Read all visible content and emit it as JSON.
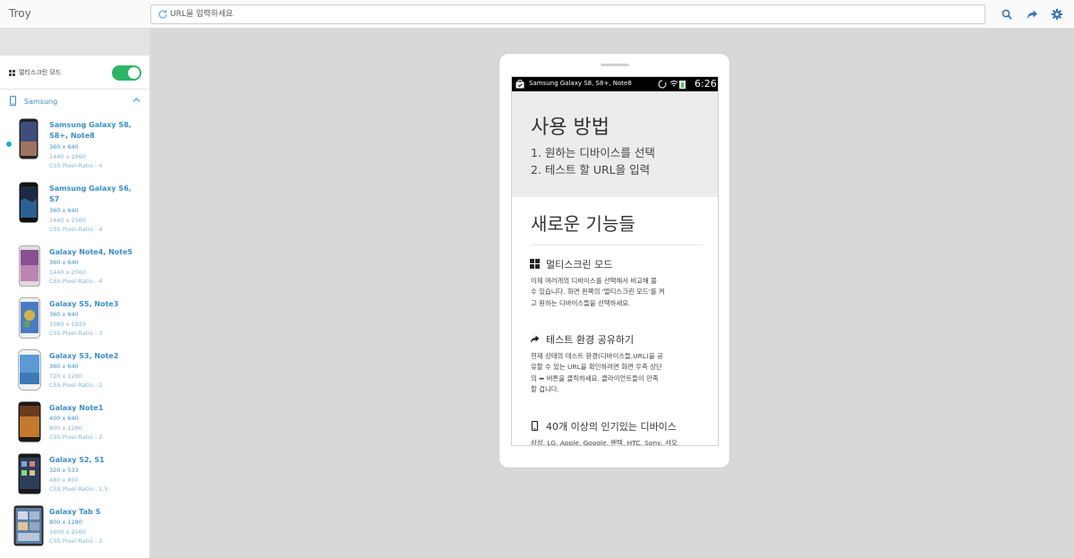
{
  "app": {
    "title": "Troy"
  },
  "urlbar": {
    "placeholder": "URL을 입력하세요",
    "value": ""
  },
  "toolbar": {
    "search_icon": "search-icon",
    "share_icon": "share-icon",
    "settings_icon": "gear-icon"
  },
  "sidebar": {
    "multiscreen": {
      "label": "멀티스크린 모드",
      "enabled": true
    },
    "group": {
      "label": "Samsung",
      "expanded": true
    },
    "devices": [
      {
        "name": "Samsung Galaxy S8, S8+, Note8",
        "viewport": "360 x 640",
        "resolution": "1440 x 2960",
        "ratio": "CSS Pixel-Ratio : 4",
        "selected": true
      },
      {
        "name": "Samsung Galaxy S6, S7",
        "viewport": "360 x 640",
        "resolution": "1440 x 2560",
        "ratio": "CSS Pixel-Ratio : 4",
        "selected": false
      },
      {
        "name": "Galaxy Note4, Note5",
        "viewport": "360 x 640",
        "resolution": "1440 x 2560",
        "ratio": "CSS Pixel-Ratio : 4",
        "selected": false
      },
      {
        "name": "Galaxy S5, Note3",
        "viewport": "360 x 640",
        "resolution": "1080 x 1920",
        "ratio": "CSS Pixel-Ratio : 3",
        "selected": false
      },
      {
        "name": "Galaxy S3, Note2",
        "viewport": "360 x 640",
        "resolution": "720 x 1280",
        "ratio": "CSS Pixel-Ratio : 2",
        "selected": false
      },
      {
        "name": "Galaxy Note1",
        "viewport": "400 x 640",
        "resolution": "800 x 1280",
        "ratio": "CSS Pixel-Ratio : 2",
        "selected": false
      },
      {
        "name": "Galaxy S2, S1",
        "viewport": "320 x 533",
        "resolution": "480 x 800",
        "ratio": "CSS Pixel-Ratio : 1.5",
        "selected": false
      },
      {
        "name": "Galaxy Tab S",
        "viewport": "800 x 1280",
        "resolution": "1600 x 2560",
        "ratio": "CSS Pixel-Ratio : 2",
        "selected": false
      }
    ]
  },
  "preview": {
    "statusbar": {
      "title": "Samsung Galaxy S8, S8+, Note8",
      "time": "6:26"
    },
    "howto": {
      "title": "사용 방법",
      "steps": [
        "1. 원하는 디바이스를 선택",
        "2. 테스트 할 URL을 입력"
      ]
    },
    "new_features": {
      "title": "새로운 기능들",
      "items": [
        {
          "icon": "grid-icon",
          "title": "멀티스크린 모드",
          "lines": [
            "이제 여러개의 디바이스를 선택해서 비교해 볼",
            "수 있습니다. 화면 왼쪽의 '멀티스크린 모드'를 켜",
            "고 원하는 디바이스들을 선택하세요."
          ]
        },
        {
          "icon": "share-icon",
          "title": "테스트 환경 공유하기",
          "lines": [
            "현재 상태의 테스트 환경(디바이스들,URL)을 공",
            "유할 수 있는 URL을 확인하려면 화면 우측 상단",
            "의 ➦ 버튼을 클릭하세요. 클라이언트들이 만족",
            "할 겁니다."
          ]
        },
        {
          "icon": "mobile-icon",
          "title": "40개 이상의 인기있는 디바이스",
          "lines": [
            "삼성, LG, Apple, Google, 팬텍, HTC, Sony, 샤오"
          ]
        }
      ]
    }
  },
  "colors": {
    "accent": "#3b8ec9",
    "toggle_on": "#2db567",
    "selected_dot": "#29a9e1"
  }
}
